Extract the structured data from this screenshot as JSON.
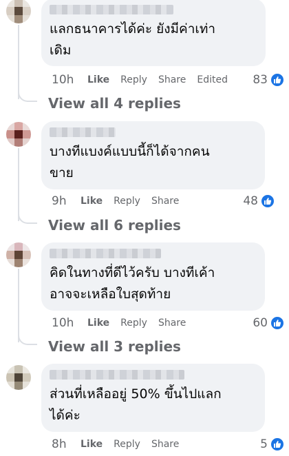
{
  "comments": [
    {
      "text": "แลกธนาคารได้ค่ะ ยังมีค่าเท่า\nเดิม",
      "time": "10h",
      "actions": {
        "like": "Like",
        "reply": "Reply",
        "share": "Share",
        "edited": "Edited"
      },
      "reaction_count": "83",
      "view_replies": "View all 4 replies"
    },
    {
      "text": "บางทีแบงค์แบบนี้ก็ได้จากคน\nขาย",
      "time": "9h",
      "actions": {
        "like": "Like",
        "reply": "Reply",
        "share": "Share"
      },
      "reaction_count": "48",
      "view_replies": "View all 6 replies"
    },
    {
      "text": "คิดในทางที่ดีไว้ครับ บางทีเค้า\nอาจจะเหลือใบสุดท้าย",
      "time": "10h",
      "actions": {
        "like": "Like",
        "reply": "Reply",
        "share": "Share"
      },
      "reaction_count": "60",
      "view_replies": "View all 3 replies"
    },
    {
      "text": "ส่วนที่เหลืออยู่ 50% ขึ้นไปแลก\nได้ค่ะ",
      "time": "8h",
      "actions": {
        "like": "Like",
        "reply": "Reply",
        "share": "Share"
      },
      "reaction_count": "5"
    }
  ],
  "colors": {
    "bubble": "#f0f2f5",
    "meta_text": "#65676b",
    "like_blue": "#1b74e4"
  }
}
